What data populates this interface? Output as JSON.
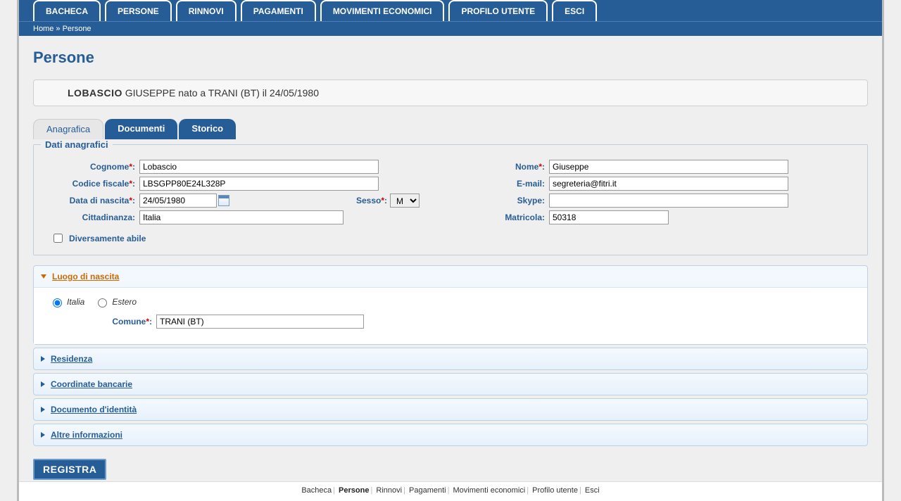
{
  "nav": {
    "tabs": [
      "BACHECA",
      "PERSONE",
      "RINNOVI",
      "PAGAMENTI",
      "MOVIMENTI ECONOMICI",
      "PROFILO UTENTE",
      "ESCI"
    ],
    "breadcrumb_home": "Home",
    "breadcrumb_sep": " » ",
    "breadcrumb_current": "Persone"
  },
  "page": {
    "title": "Persone",
    "header_surname": "LOBASCIO",
    "header_rest": " GIUSEPPE nato a TRANI (BT) il 24/05/1980"
  },
  "formTabs": {
    "anagrafica": "Anagrafica",
    "documenti": "Documenti",
    "storico": "Storico"
  },
  "fieldset": {
    "legend": "Dati anagrafici",
    "labels": {
      "cognome": "Cognome",
      "nome": "Nome",
      "codice_fiscale": "Codice fiscale",
      "email": "E-mail",
      "data_nascita": "Data di nascita",
      "sesso": "Sesso",
      "skype": "Skype",
      "cittadinanza": "Cittadinanza",
      "matricola": "Matricola",
      "diversamente_abile": "Diversamente abile"
    },
    "values": {
      "cognome": "Lobascio",
      "nome": "Giuseppe",
      "codice_fiscale": "LBSGPP80E24L328P",
      "email": "segreteria@fitri.it",
      "data_nascita": "24/05/1980",
      "sesso": "M",
      "skype": "",
      "cittadinanza": "Italia",
      "matricola": "50318",
      "diversamente_abile": false
    }
  },
  "accordion": {
    "luogo": {
      "title": "Luogo di nascita",
      "radio_italia": "Italia",
      "radio_estero": "Estero",
      "comune_label": "Comune",
      "comune_value": "TRANI (BT)"
    },
    "residenza": "Residenza",
    "coordinate": "Coordinate bancarie",
    "documento": "Documento d'identità",
    "altre": "Altre informazioni"
  },
  "actions": {
    "registra": "REGISTRA"
  },
  "footer": {
    "items": [
      "Bacheca",
      "Persone",
      "Rinnovi",
      "Pagamenti",
      "Movimenti economici",
      "Profilo utente",
      "Esci"
    ],
    "active_index": 1
  }
}
